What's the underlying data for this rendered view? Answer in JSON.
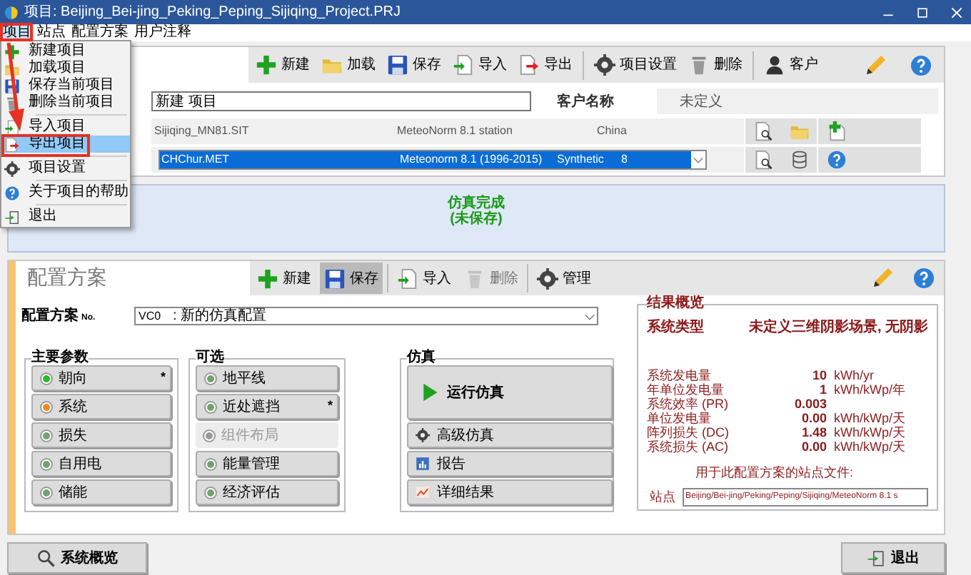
{
  "window": {
    "title": "项目: Beijing_Bei-jing_Peking_Peping_Sijiqing_Project.PRJ"
  },
  "menu_bar": [
    {
      "label": "项目",
      "selected": true
    },
    {
      "label": "站点",
      "selected": false
    },
    {
      "label": "配置方案",
      "selected": false
    },
    {
      "label": "用户注释",
      "selected": false
    }
  ],
  "dropdown_menu": [
    {
      "kind": "item",
      "label": "新建项目",
      "selected": false
    },
    {
      "kind": "item",
      "label": "加载项目",
      "selected": false
    },
    {
      "kind": "item",
      "label": "保存当前项目",
      "selected": false
    },
    {
      "kind": "item",
      "label": "删除当前项目",
      "selected": false
    },
    {
      "kind": "separator"
    },
    {
      "kind": "item",
      "label": "导入项目",
      "selected": false
    },
    {
      "kind": "item",
      "label": "导出项目",
      "selected": true
    },
    {
      "kind": "separator"
    },
    {
      "kind": "item",
      "label": "项目设置",
      "selected": false
    },
    {
      "kind": "separator"
    },
    {
      "kind": "item",
      "label": "关于项目的帮助",
      "selected": false
    },
    {
      "kind": "separator"
    },
    {
      "kind": "item",
      "label": "退出",
      "selected": false
    }
  ],
  "project_toolbar": [
    {
      "label": "新建"
    },
    {
      "label": "加载"
    },
    {
      "label": "保存"
    },
    {
      "label": "导入"
    },
    {
      "label": "导出"
    },
    {
      "label": "项目设置"
    },
    {
      "label": "删除"
    },
    {
      "label": "客户"
    }
  ],
  "project": {
    "name": "新建 项目",
    "client_label": "客户名称",
    "client": "未定义"
  },
  "site": {
    "file": "Sijiqing_MN81.SIT",
    "source": "MeteoNorm 8.1 station",
    "country": "China"
  },
  "meteo": {
    "file": "CHChur.MET",
    "source": "Meteonorm 8.1 (1996-2015)",
    "type": "Synthetic",
    "column_4": "8"
  },
  "status": {
    "line_1": "仿真完成",
    "line_2": "(未保存)"
  },
  "variant": {
    "title": "配置方案",
    "toolbar": [
      {
        "label": "新建",
        "pressed": false,
        "disabled": false
      },
      {
        "label": "保存",
        "pressed": true,
        "disabled": false
      },
      {
        "label": "导入",
        "pressed": false,
        "disabled": false
      },
      {
        "label": "删除",
        "pressed": false,
        "disabled": true
      },
      {
        "label": "管理",
        "pressed": false,
        "disabled": false
      }
    ],
    "number_label": "配置方案",
    "number_suffix": "No.",
    "number_code": "VC0",
    "number_name": ": 新的仿真配置"
  },
  "main_parameters": {
    "title": "主要参数",
    "items": [
      {
        "label": "朝向",
        "color": "#22c022",
        "mark": "*",
        "disabled": false
      },
      {
        "label": "系统",
        "color": "#f08a1c",
        "disabled": false
      },
      {
        "label": "损失",
        "color": "#6fa36f",
        "disabled": false
      },
      {
        "label": "自用电",
        "color": "#6fa36f",
        "disabled": false
      },
      {
        "label": "储能",
        "color": "#6fa36f",
        "disabled": false
      }
    ]
  },
  "optional": {
    "title": "可选",
    "items": [
      {
        "label": "地平线",
        "color": "#6fa36f",
        "disabled": false
      },
      {
        "label": "近处遮挡",
        "color": "#6fa36f",
        "mark": "*",
        "disabled": false
      },
      {
        "label": "组件布局",
        "color": "#9a9a9a",
        "disabled": true
      },
      {
        "label": "能量管理",
        "color": "#6fa36f",
        "disabled": false
      },
      {
        "label": "经济评估",
        "color": "#6fa36f",
        "disabled": false
      }
    ]
  },
  "simulation": {
    "title": "仿真",
    "buttons": [
      {
        "kind": "run",
        "label": "运行仿真"
      },
      {
        "kind": "advanced",
        "label": "高级仿真"
      },
      {
        "kind": "report",
        "label": "报告"
      },
      {
        "kind": "results",
        "label": "详细结果"
      }
    ]
  },
  "results_overview": {
    "title": "结果概览",
    "system_type_label": "系统类型",
    "system_type": "未定义三维阴影场景, 无阴影",
    "rows": [
      {
        "label": "系统发电量",
        "value": "10",
        "unit": "kWh/yr"
      },
      {
        "label": "年单位发电量",
        "value": "1",
        "unit": "kWh/kWp/年"
      },
      {
        "label": "系统效率 (PR)",
        "value": "0.003"
      },
      {
        "label": "单位发电量",
        "value": "0.00",
        "unit": "kWh/kWp/天"
      },
      {
        "label": "阵列损失 (DC)",
        "value": "1.48",
        "unit": "kWh/kWp/天"
      },
      {
        "label": "系统损失 (AC)",
        "value": "0.00",
        "unit": "kWh/kWp/天"
      }
    ],
    "site_file_note": "用于此配置方案的站点文件:",
    "site_label": "站点",
    "site_file": "Beijing/Bei-jing/Peking/Peping/Sijiqing/MeteoNorm 8.1 s"
  },
  "bottom_buttons": [
    {
      "kind": "overview",
      "label": "系统概览"
    },
    {
      "kind": "exit",
      "label": "退出"
    }
  ]
}
